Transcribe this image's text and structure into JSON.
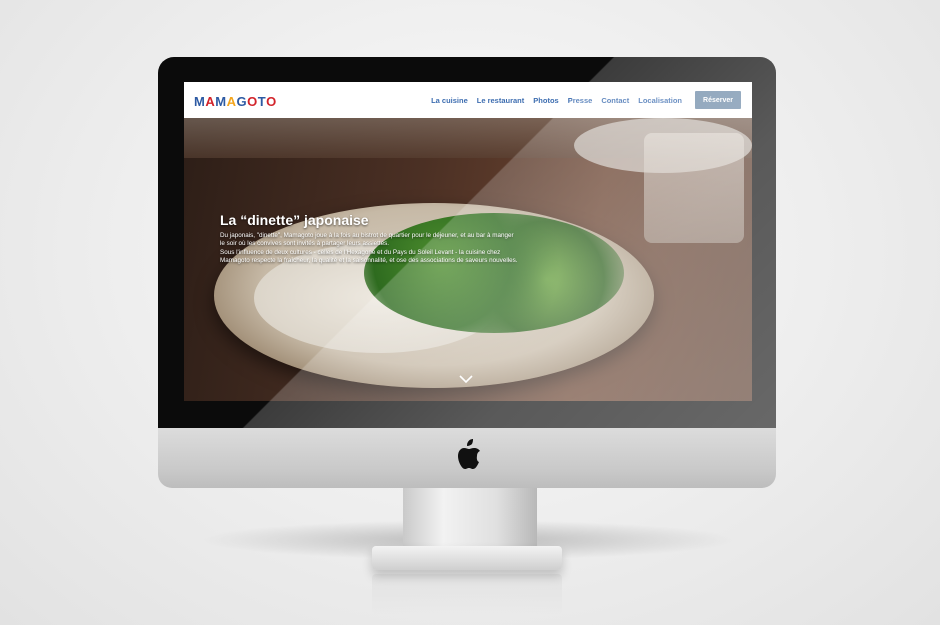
{
  "brand": {
    "logo_letters": [
      "M",
      "A",
      "M",
      "A",
      "G",
      "O",
      "T",
      "O"
    ],
    "logo_colors": [
      "#2d5aa3",
      "#d2232a",
      "#2d5aa3",
      "#f4a51c",
      "#2d5aa3",
      "#d2232a",
      "#2d5aa3",
      "#d2232a"
    ]
  },
  "nav": {
    "items": [
      "La cuisine",
      "Le restaurant",
      "Photos",
      "Presse",
      "Contact",
      "Localisation"
    ],
    "reserve_label": "Réserver"
  },
  "hero": {
    "title": "La “dinette” japonaise",
    "paragraphs": [
      "Du japonais, \"dinette\", Mamagoto joue à la fois au bistrot de quartier pour le déjeuner, et au bar à manger le soir où les convives sont invités à partager leurs assiettes.",
      "Sous l'influence de deux cultures - celles de l'Hexagone et du Pays du Soleil Levant - la cuisine chez Mamagoto respecte la fraîcheur, la qualité et la saisonnalité, et ose des associations de saveurs nouvelles."
    ],
    "scroll_icon": "chevron-down-icon"
  },
  "device": {
    "chin_icon": "apple-icon"
  },
  "colors": {
    "nav_link": "#3d6db0",
    "reserve_bg": "#6e8ba8"
  }
}
